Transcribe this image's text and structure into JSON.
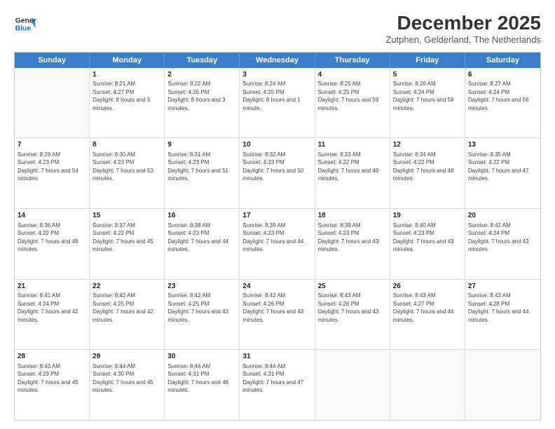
{
  "logo": {
    "line1": "General",
    "line2": "Blue"
  },
  "title": "December 2025",
  "subtitle": "Zutphen, Gelderland, The Netherlands",
  "weekdays": [
    "Sunday",
    "Monday",
    "Tuesday",
    "Wednesday",
    "Thursday",
    "Friday",
    "Saturday"
  ],
  "rows": [
    [
      {
        "day": "",
        "sunrise": "",
        "sunset": "",
        "daylight": ""
      },
      {
        "day": "1",
        "sunrise": "Sunrise: 8:21 AM",
        "sunset": "Sunset: 4:27 PM",
        "daylight": "Daylight: 8 hours and 5 minutes."
      },
      {
        "day": "2",
        "sunrise": "Sunrise: 8:22 AM",
        "sunset": "Sunset: 4:26 PM",
        "daylight": "Daylight: 8 hours and 3 minutes."
      },
      {
        "day": "3",
        "sunrise": "Sunrise: 8:24 AM",
        "sunset": "Sunset: 4:25 PM",
        "daylight": "Daylight: 8 hours and 1 minute."
      },
      {
        "day": "4",
        "sunrise": "Sunrise: 8:25 AM",
        "sunset": "Sunset: 4:25 PM",
        "daylight": "Daylight: 7 hours and 59 minutes."
      },
      {
        "day": "5",
        "sunrise": "Sunrise: 8:26 AM",
        "sunset": "Sunset: 4:24 PM",
        "daylight": "Daylight: 7 hours and 58 minutes."
      },
      {
        "day": "6",
        "sunrise": "Sunrise: 8:27 AM",
        "sunset": "Sunset: 4:24 PM",
        "daylight": "Daylight: 7 hours and 56 minutes."
      }
    ],
    [
      {
        "day": "7",
        "sunrise": "Sunrise: 8:29 AM",
        "sunset": "Sunset: 4:23 PM",
        "daylight": "Daylight: 7 hours and 54 minutes."
      },
      {
        "day": "8",
        "sunrise": "Sunrise: 8:30 AM",
        "sunset": "Sunset: 4:23 PM",
        "daylight": "Daylight: 7 hours and 53 minutes."
      },
      {
        "day": "9",
        "sunrise": "Sunrise: 8:31 AM",
        "sunset": "Sunset: 4:23 PM",
        "daylight": "Daylight: 7 hours and 51 minutes."
      },
      {
        "day": "10",
        "sunrise": "Sunrise: 8:32 AM",
        "sunset": "Sunset: 4:23 PM",
        "daylight": "Daylight: 7 hours and 50 minutes."
      },
      {
        "day": "11",
        "sunrise": "Sunrise: 8:33 AM",
        "sunset": "Sunset: 4:22 PM",
        "daylight": "Daylight: 7 hours and 49 minutes."
      },
      {
        "day": "12",
        "sunrise": "Sunrise: 8:34 AM",
        "sunset": "Sunset: 4:22 PM",
        "daylight": "Daylight: 7 hours and 48 minutes."
      },
      {
        "day": "13",
        "sunrise": "Sunrise: 8:35 AM",
        "sunset": "Sunset: 4:22 PM",
        "daylight": "Daylight: 7 hours and 47 minutes."
      }
    ],
    [
      {
        "day": "14",
        "sunrise": "Sunrise: 8:36 AM",
        "sunset": "Sunset: 4:22 PM",
        "daylight": "Daylight: 7 hours and 46 minutes."
      },
      {
        "day": "15",
        "sunrise": "Sunrise: 8:37 AM",
        "sunset": "Sunset: 4:22 PM",
        "daylight": "Daylight: 7 hours and 45 minutes."
      },
      {
        "day": "16",
        "sunrise": "Sunrise: 8:38 AM",
        "sunset": "Sunset: 4:23 PM",
        "daylight": "Daylight: 7 hours and 44 minutes."
      },
      {
        "day": "17",
        "sunrise": "Sunrise: 8:39 AM",
        "sunset": "Sunset: 4:23 PM",
        "daylight": "Daylight: 7 hours and 44 minutes."
      },
      {
        "day": "18",
        "sunrise": "Sunrise: 8:39 AM",
        "sunset": "Sunset: 4:23 PM",
        "daylight": "Daylight: 7 hours and 43 minutes."
      },
      {
        "day": "19",
        "sunrise": "Sunrise: 8:40 AM",
        "sunset": "Sunset: 4:23 PM",
        "daylight": "Daylight: 7 hours and 43 minutes."
      },
      {
        "day": "20",
        "sunrise": "Sunrise: 8:41 AM",
        "sunset": "Sunset: 4:24 PM",
        "daylight": "Daylight: 7 hours and 43 minutes."
      }
    ],
    [
      {
        "day": "21",
        "sunrise": "Sunrise: 8:41 AM",
        "sunset": "Sunset: 4:24 PM",
        "daylight": "Daylight: 7 hours and 42 minutes."
      },
      {
        "day": "22",
        "sunrise": "Sunrise: 8:42 AM",
        "sunset": "Sunset: 4:25 PM",
        "daylight": "Daylight: 7 hours and 42 minutes."
      },
      {
        "day": "23",
        "sunrise": "Sunrise: 8:42 AM",
        "sunset": "Sunset: 4:25 PM",
        "daylight": "Daylight: 7 hours and 43 minutes."
      },
      {
        "day": "24",
        "sunrise": "Sunrise: 8:42 AM",
        "sunset": "Sunset: 4:26 PM",
        "daylight": "Daylight: 7 hours and 43 minutes."
      },
      {
        "day": "25",
        "sunrise": "Sunrise: 8:43 AM",
        "sunset": "Sunset: 4:26 PM",
        "daylight": "Daylight: 7 hours and 43 minutes."
      },
      {
        "day": "26",
        "sunrise": "Sunrise: 8:43 AM",
        "sunset": "Sunset: 4:27 PM",
        "daylight": "Daylight: 7 hours and 44 minutes."
      },
      {
        "day": "27",
        "sunrise": "Sunrise: 8:43 AM",
        "sunset": "Sunset: 4:28 PM",
        "daylight": "Daylight: 7 hours and 44 minutes."
      }
    ],
    [
      {
        "day": "28",
        "sunrise": "Sunrise: 8:43 AM",
        "sunset": "Sunset: 4:29 PM",
        "daylight": "Daylight: 7 hours and 45 minutes."
      },
      {
        "day": "29",
        "sunrise": "Sunrise: 8:44 AM",
        "sunset": "Sunset: 4:30 PM",
        "daylight": "Daylight: 7 hours and 45 minutes."
      },
      {
        "day": "30",
        "sunrise": "Sunrise: 8:44 AM",
        "sunset": "Sunset: 4:31 PM",
        "daylight": "Daylight: 7 hours and 46 minutes."
      },
      {
        "day": "31",
        "sunrise": "Sunrise: 8:44 AM",
        "sunset": "Sunset: 4:31 PM",
        "daylight": "Daylight: 7 hours and 47 minutes."
      },
      {
        "day": "",
        "sunrise": "",
        "sunset": "",
        "daylight": ""
      },
      {
        "day": "",
        "sunrise": "",
        "sunset": "",
        "daylight": ""
      },
      {
        "day": "",
        "sunrise": "",
        "sunset": "",
        "daylight": ""
      }
    ]
  ]
}
